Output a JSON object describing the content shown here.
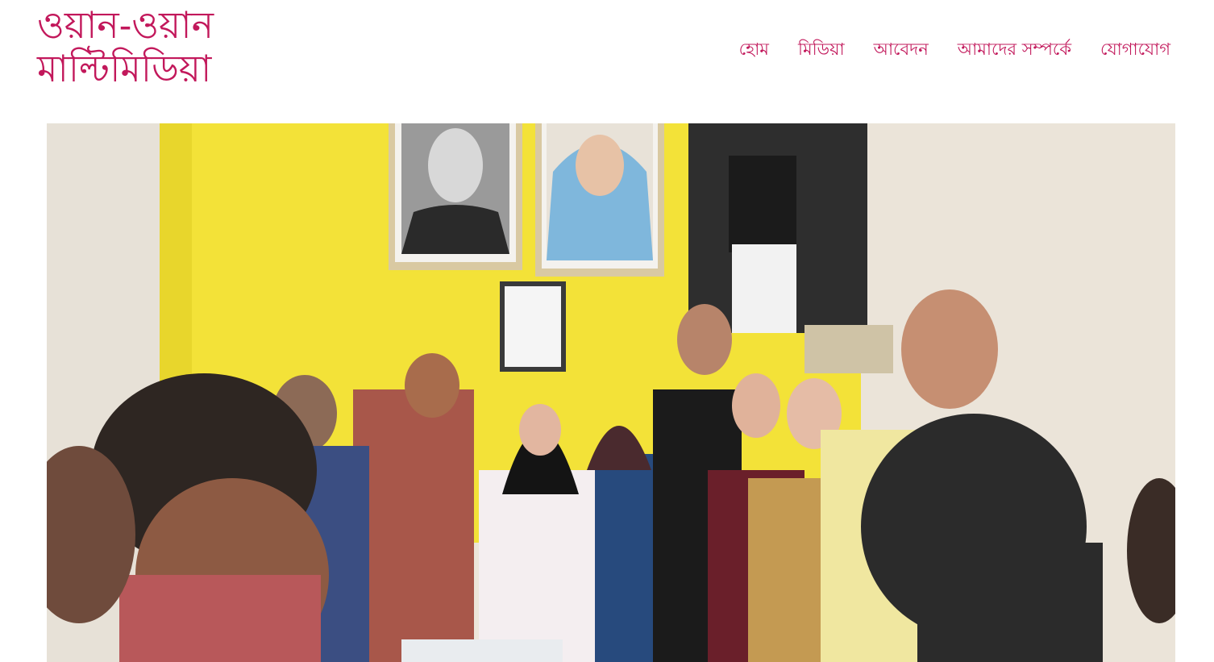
{
  "site": {
    "logo_line1": "ওয়ান-ওয়ান",
    "logo_line2": "মাল্টিমিডিয়া",
    "brand_color": "#c2185b"
  },
  "nav": {
    "items": [
      {
        "label": "হোম"
      },
      {
        "label": "মিডিয়া"
      },
      {
        "label": "আবেদন"
      },
      {
        "label": "আমাদের সম্পর্কে"
      },
      {
        "label": "যোগাযোগ"
      }
    ]
  },
  "slider": {
    "prev_icon": "chevron-left-icon",
    "next_icon": "chevron-right-icon",
    "prev_glyph": "‹",
    "next_glyph": "›"
  }
}
